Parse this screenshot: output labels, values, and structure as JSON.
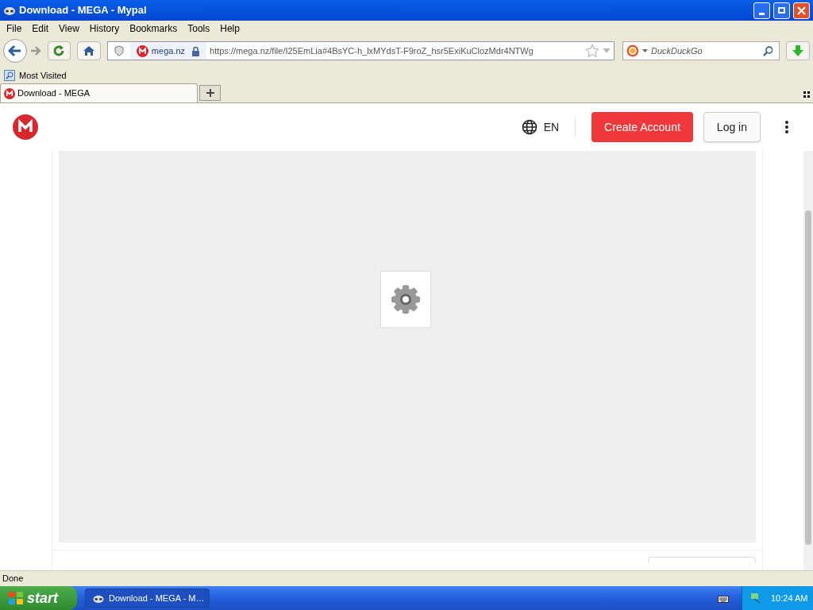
{
  "window": {
    "title": "Download - MEGA - Mypal"
  },
  "menu": [
    "File",
    "Edit",
    "View",
    "History",
    "Bookmarks",
    "Tools",
    "Help"
  ],
  "address_bar": {
    "site": "mega.nz",
    "url": "https://mega.nz/file/I25EmLia#4BsYC-h_lxMYdsT-F9roZ_hsr5ExiKuClozMdr4NTWg"
  },
  "search": {
    "placeholder": "DuckDuckGo"
  },
  "bookmarks": [
    "Most Visited"
  ],
  "tabs": [
    {
      "label": "Download - MEGA",
      "selected": true
    }
  ],
  "page": {
    "language": "EN",
    "buttons": [
      "Create Account",
      "Log in"
    ]
  },
  "status_bar": "Done",
  "taskbar": {
    "start": "start",
    "tasks": [
      "Download - MEGA - M…"
    ],
    "clock": "10:24 AM"
  }
}
